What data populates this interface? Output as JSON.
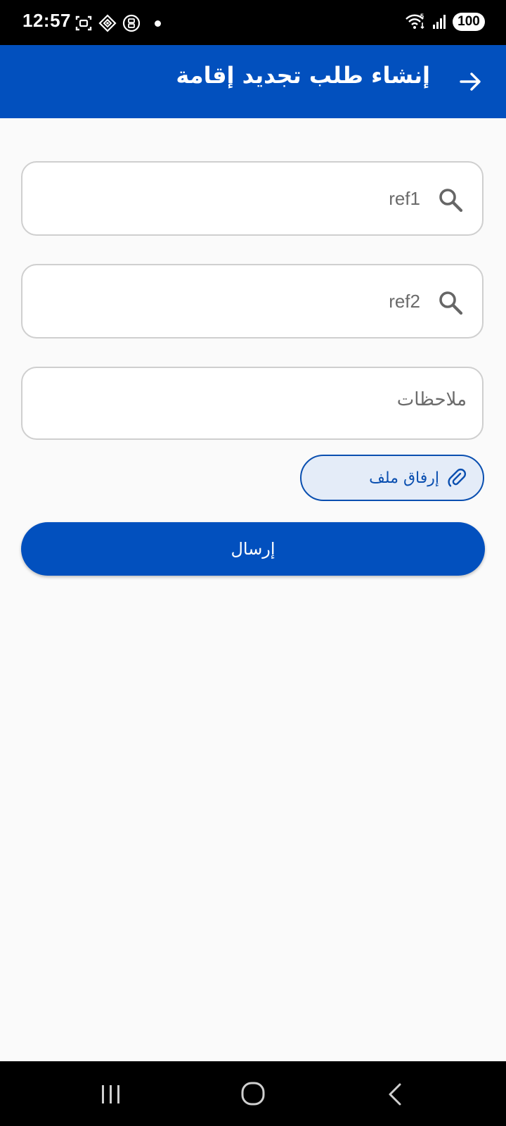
{
  "status_bar": {
    "time": "12:57",
    "battery": "100",
    "icons_left": [
      "screenshot-icon",
      "nfc-icon",
      "app-notification-icon",
      "notification-dot"
    ],
    "icons_right": [
      "wifi-icon",
      "signal-icon",
      "battery-icon"
    ]
  },
  "app_bar": {
    "title": "إنشاء طلب تجديد إقامة",
    "back_icon": "arrow-forward-icon"
  },
  "form": {
    "ref1_value": "ref1",
    "ref2_value": "ref2",
    "notes_placeholder": "ملاحظات",
    "attach_label": "إرفاق ملف",
    "send_label": "إرسال"
  },
  "nav_bar": {
    "icons": [
      "recents-icon",
      "home-icon",
      "back-icon"
    ]
  },
  "colors": {
    "primary": "#0250BE",
    "background": "#FAFAFA",
    "field_border": "#CFCFCF",
    "attach_bg": "#E4ECF8"
  }
}
